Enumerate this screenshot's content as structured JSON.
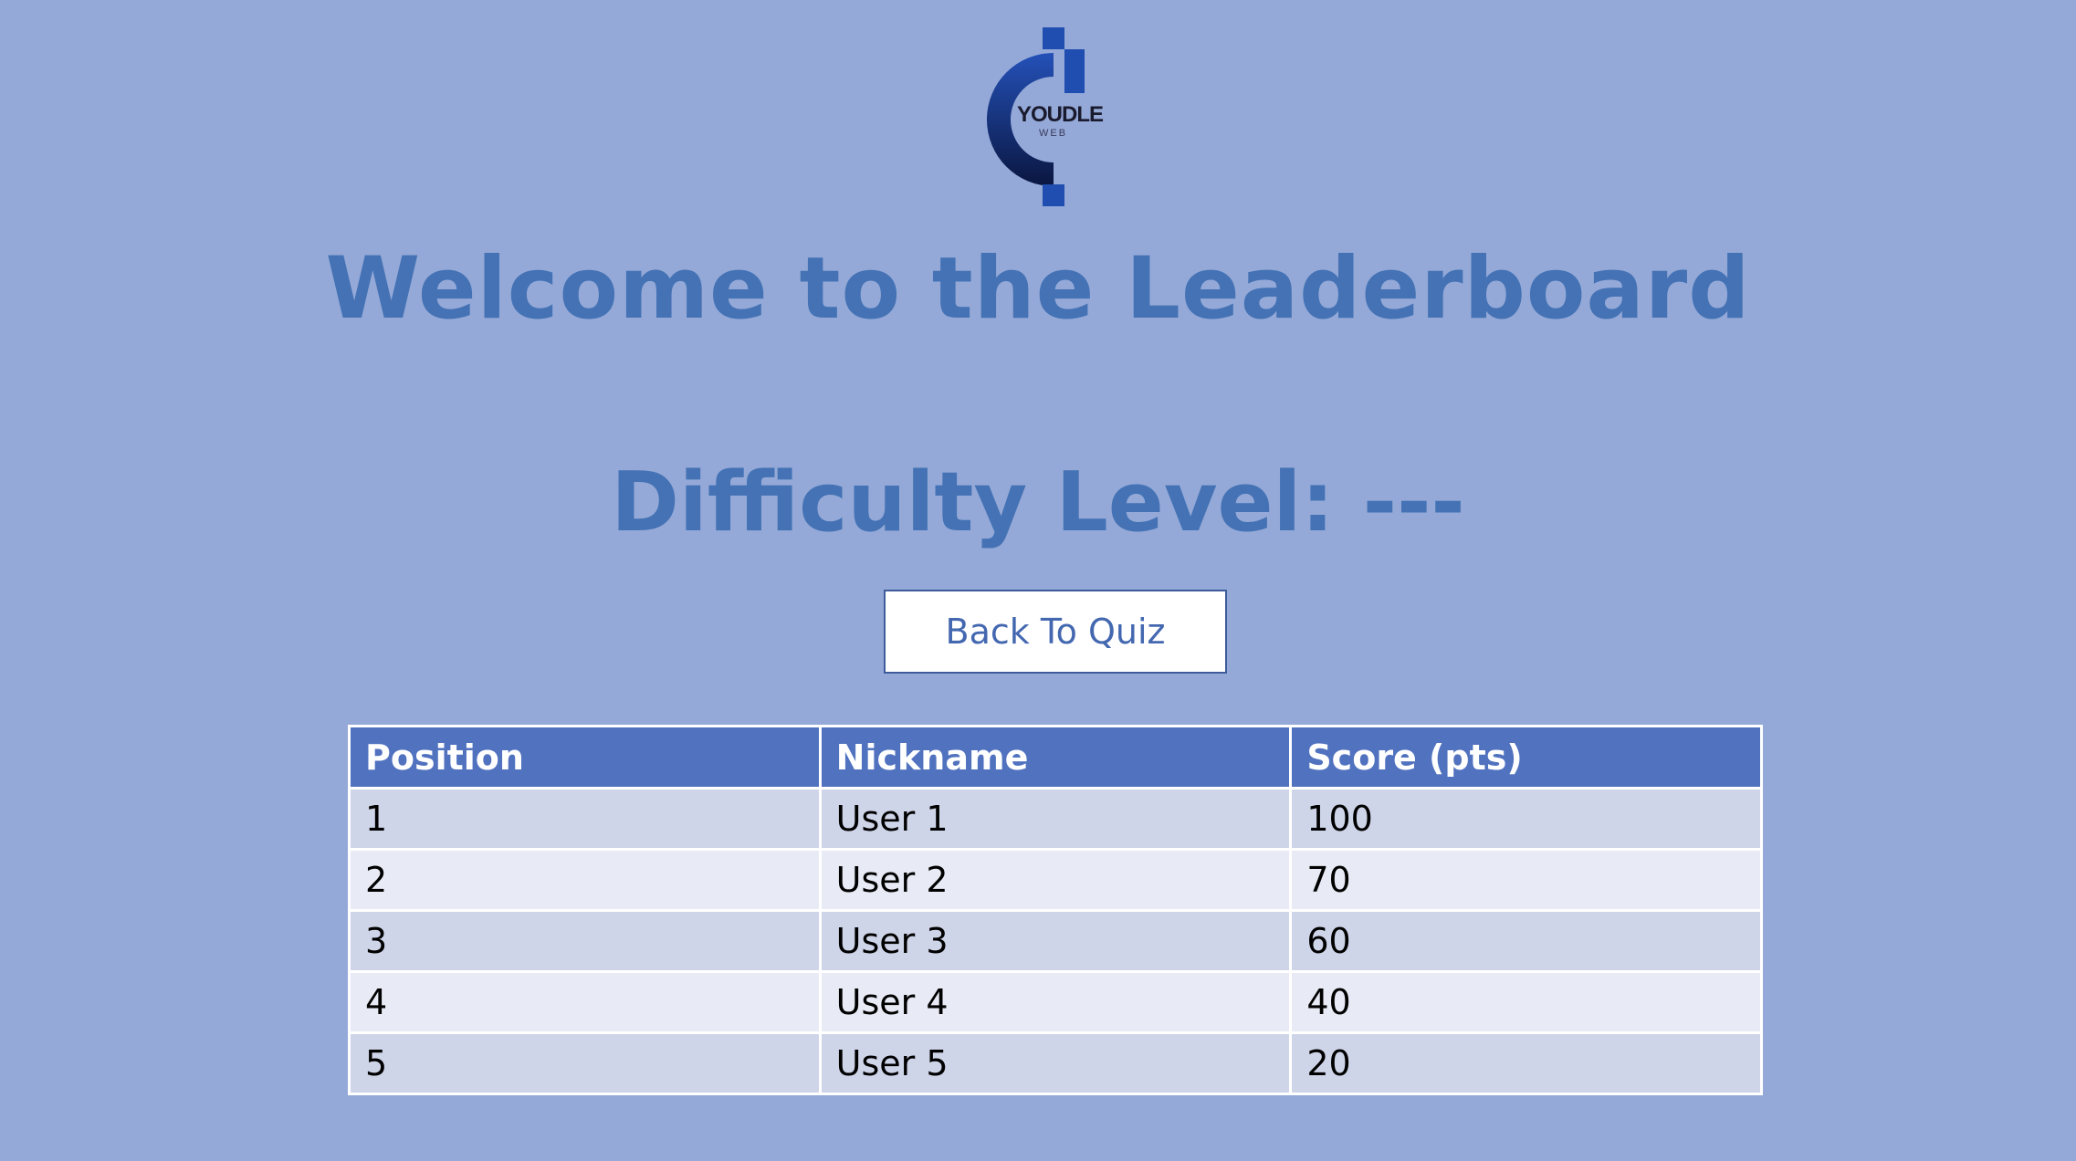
{
  "logo": {
    "text": "YOUDLE",
    "subtext": "WEB",
    "colors": {
      "primary": "#1f4db0",
      "dark": "#0c1a4a"
    }
  },
  "header": {
    "title": "Welcome to the Leaderboard",
    "difficulty": "Difficulty Level: ---"
  },
  "actions": {
    "back_label": "Back To Quiz"
  },
  "leaderboard": {
    "columns": [
      "Position",
      "Nickname",
      "Score (pts)"
    ],
    "rows": [
      [
        "1",
        "User 1",
        "100"
      ],
      [
        "2",
        "User 2",
        "70"
      ],
      [
        "3",
        "User 3",
        "60"
      ],
      [
        "4",
        "User 4",
        "40"
      ],
      [
        "5",
        "User 5",
        "20"
      ]
    ]
  },
  "theme": {
    "background": "#94a9d8",
    "heading_color": "#4472b4",
    "table_header": "#5072bf",
    "row_odd": "#cfd5e9",
    "row_even": "#e8ebf5"
  }
}
